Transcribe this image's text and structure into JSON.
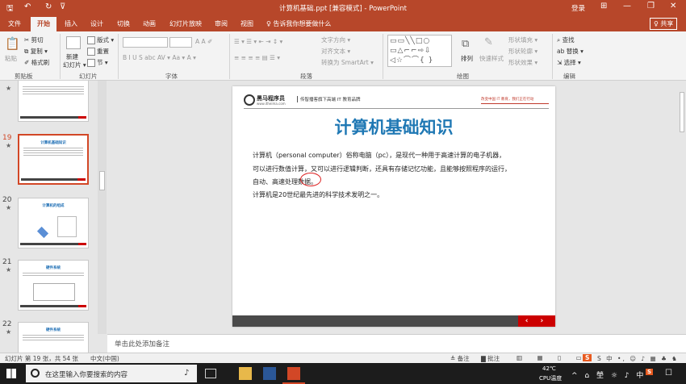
{
  "window": {
    "title": "计算机基础.ppt [兼容模式] - PowerPoint",
    "login": "登录",
    "qa_save": "🖫",
    "qa_undo": "↶",
    "qa_redo": "↻",
    "qa_custom": "⊽",
    "ctrl_ribbon": "⊞",
    "ctrl_min": "—",
    "ctrl_max": "❐",
    "ctrl_close": "✕"
  },
  "menu": {
    "items": [
      "文件",
      "开始",
      "插入",
      "设计",
      "切换",
      "动画",
      "幻灯片放映",
      "审阅",
      "视图"
    ],
    "active": "开始",
    "tell_me": "♀ 告诉我你想要做什么",
    "share": "♀ 共享"
  },
  "ribbon": {
    "paste": "粘贴",
    "cut": "✂ 剪切",
    "copy": "⧉ 复制 ▾",
    "format_painter": "✐ 格式刷",
    "clipboard": "剪贴板",
    "new_slide": "新建",
    "new_slide2": "幻灯片 ▾",
    "layout": "版式 ▾",
    "reset": "重置",
    "section": "节 ▾",
    "slides": "幻灯片",
    "font_row2": "B I U S abc AV ▾ Aa ▾ A ▾",
    "font": "字体",
    "para_row1": "☰ ▾ ☰ ▾ ⇤ ⇥ ↕ ▾",
    "para_row2": "≡ ≡ ≡ ≡ ▤ ☰ ▾",
    "text_dir": "文字方向 ▾",
    "align_text": "对齐文本 ▾",
    "smartart": "转换为 SmartArt ▾",
    "paragraph": "段落",
    "shapes_preview": "▭▭╲╲□○ ▭△⌐⌐⇨⇩ ◁☆⌒⌒{ }",
    "arrange": "排列",
    "quick_styles": "快速样式",
    "shape_fill": "形状填充 ▾",
    "shape_outline": "形状轮廓 ▾",
    "shape_effects": "形状效果 ▾",
    "drawing": "绘图",
    "find": "⌕ 查找",
    "replace": "ab 替换 ▾",
    "select": "⇲ 选择 ▾",
    "editing": "编辑"
  },
  "thumbnails": [
    {
      "num": "",
      "title": "",
      "top": 0
    },
    {
      "num": "19",
      "title": "计算机基础知识",
      "selected": true
    },
    {
      "num": "20",
      "title": "计算机的组成"
    },
    {
      "num": "21",
      "title": "硬件系统"
    },
    {
      "num": "22",
      "title": "硬件系统"
    }
  ],
  "star": "★",
  "slide": {
    "brand": "黑马程序员",
    "brand_url": "www.itheima.com",
    "tagline": "传智播客旗下高端 IT 教育品牌",
    "slogan": "改变中国 IT 教育，我们正在行动",
    "title": "计算机基础知识",
    "body": [
      "计算机（personal computer）俗称电脑（pc），是现代一种用于高速计算的电子机器，",
      "可以进行数值计算，又可以进行逻辑判断，还具有存储记忆功能，且能够按照程序的运行，",
      "自动、高速处理数据。",
      "计算机是20世纪最先进的科学技术发明之一。"
    ],
    "nav": "‹ ›"
  },
  "notes": {
    "placeholder": "单击此处添加备注"
  },
  "status": {
    "slide_info": "幻灯片 第 19 张，共 54 张",
    "language": "中文(中国)",
    "notes_btn": "≜ 备注",
    "comments_btn": "▇ 批注",
    "views": "▥ ▦ ▯ ▭",
    "zoom_icons": "S 中 •, ☺ ♪ ▦ ♣ ♞ ↗"
  },
  "taskbar": {
    "search_placeholder": "在这里输入你要搜索的内容",
    "mic": "♪",
    "temp": "42℃",
    "temp_label": "CPU温度",
    "tray": "^ ⌂ 塋 ☼ ♪ 中",
    "ime_s": "S",
    "chat": "☐"
  }
}
